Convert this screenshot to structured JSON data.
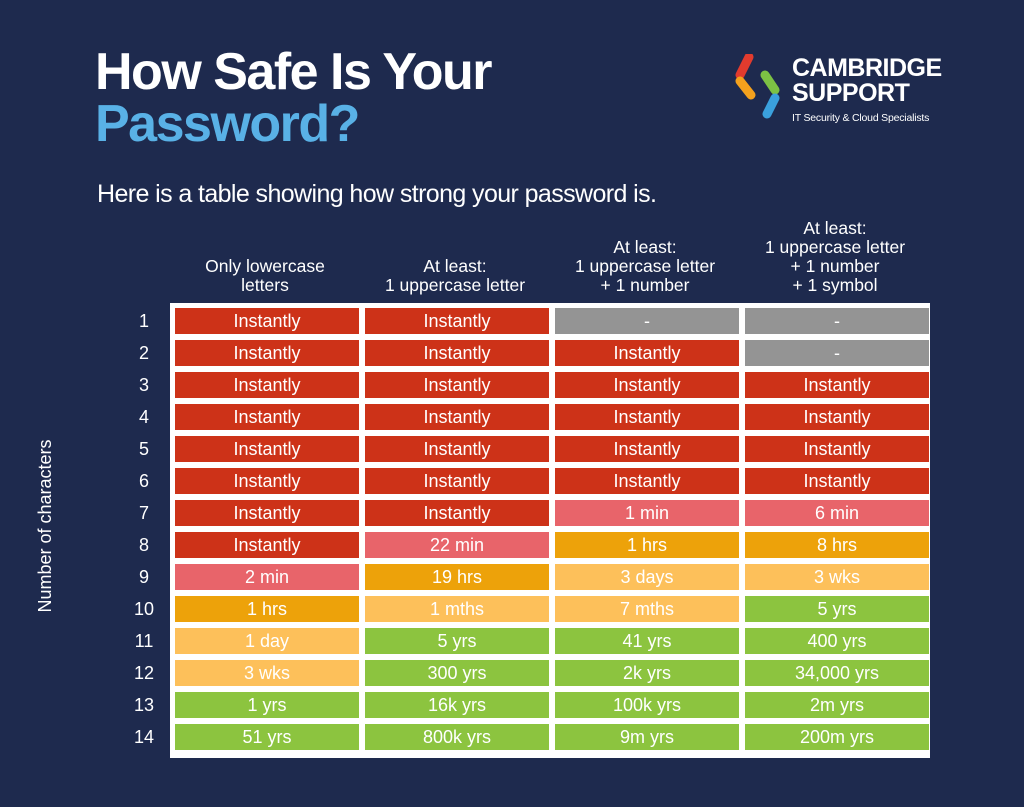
{
  "header": {
    "title_line1": "How Safe Is Your",
    "title_line2": "Password?",
    "subtitle": "Here is a table showing how strong your password is."
  },
  "logo": {
    "line1": "CAMBRIDGE",
    "line2": "SUPPORT",
    "tagline": "IT Security & Cloud Specialists",
    "colors": [
      "#e23b2e",
      "#f4a11d",
      "#7cc144",
      "#3aa0dd"
    ]
  },
  "table": {
    "row_axis_label": "Number of characters",
    "columns": [
      [
        "Only lowercase",
        "letters"
      ],
      [
        "At least:",
        "1 uppercase letter"
      ],
      [
        "At least:",
        "1 uppercase letter",
        "+ 1 number"
      ],
      [
        "At least:",
        "1 uppercase letter",
        "+ 1 number",
        "+ 1 symbol"
      ]
    ],
    "row_labels": [
      "1",
      "2",
      "3",
      "4",
      "5",
      "6",
      "7",
      "8",
      "9",
      "10",
      "11",
      "12",
      "13",
      "14"
    ],
    "cells": [
      [
        "Instantly",
        "Instantly",
        "-",
        "-"
      ],
      [
        "Instantly",
        "Instantly",
        "Instantly",
        "-"
      ],
      [
        "Instantly",
        "Instantly",
        "Instantly",
        "Instantly"
      ],
      [
        "Instantly",
        "Instantly",
        "Instantly",
        "Instantly"
      ],
      [
        "Instantly",
        "Instantly",
        "Instantly",
        "Instantly"
      ],
      [
        "Instantly",
        "Instantly",
        "Instantly",
        "Instantly"
      ],
      [
        "Instantly",
        "Instantly",
        "1 min",
        "6 min"
      ],
      [
        "Instantly",
        "22 min",
        "1 hrs",
        "8 hrs"
      ],
      [
        "2 min",
        "19 hrs",
        "3 days",
        "3 wks"
      ],
      [
        "1 hrs",
        "1 mths",
        "7 mths",
        "5 yrs"
      ],
      [
        "1 day",
        "5 yrs",
        "41 yrs",
        "400 yrs"
      ],
      [
        "3 wks",
        "300 yrs",
        "2k yrs",
        "34,000 yrs"
      ],
      [
        "1 yrs",
        "16k yrs",
        "100k yrs",
        "2m yrs"
      ],
      [
        "51 yrs",
        "800k yrs",
        "9m yrs",
        "200m yrs"
      ]
    ],
    "levels": [
      [
        "red",
        "red",
        "gray",
        "gray"
      ],
      [
        "red",
        "red",
        "red",
        "gray"
      ],
      [
        "red",
        "red",
        "red",
        "red"
      ],
      [
        "red",
        "red",
        "red",
        "red"
      ],
      [
        "red",
        "red",
        "red",
        "red"
      ],
      [
        "red",
        "red",
        "red",
        "red"
      ],
      [
        "red",
        "red",
        "pink",
        "pink"
      ],
      [
        "red",
        "pink",
        "orange",
        "orange"
      ],
      [
        "pink",
        "orange",
        "yellow",
        "yellow"
      ],
      [
        "orange",
        "yellow",
        "yellow",
        "green"
      ],
      [
        "yellow",
        "green",
        "green",
        "green"
      ],
      [
        "yellow",
        "green",
        "green",
        "green"
      ],
      [
        "green",
        "green",
        "green",
        "green"
      ],
      [
        "green",
        "green",
        "green",
        "green"
      ]
    ],
    "level_colors": {
      "red": "#cd3218",
      "pink": "#e8646a",
      "orange": "#eda20a",
      "yellow": "#fdc05a",
      "green": "#8cc43f",
      "gray": "#949494"
    }
  }
}
